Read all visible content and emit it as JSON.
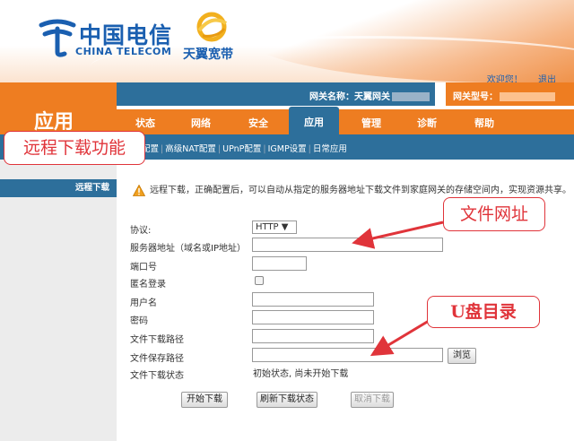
{
  "header": {
    "brand_cn": "中国电信",
    "brand_en": "CHINA TELECOM",
    "sub_brand": "天翼宽带",
    "welcome": "欢迎您！",
    "logout": "退出"
  },
  "app_title": "应用",
  "info_bar": {
    "gateway_name_label": "网关名称：天翼网关",
    "gateway_model_label": "网关型号："
  },
  "tabs": [
    {
      "label": "状态"
    },
    {
      "label": "网络"
    },
    {
      "label": "安全"
    },
    {
      "label": "应用"
    },
    {
      "label": "管理"
    },
    {
      "label": "诊断"
    },
    {
      "label": "帮助"
    }
  ],
  "subnav": [
    "S配置",
    "高级NAT配置",
    "UPnP配置",
    "IGMP设置",
    "日常应用"
  ],
  "sidebar": {
    "items": [
      {
        "label": "远程下载"
      }
    ]
  },
  "notice": "远程下载，正确配置后，可以自动从指定的服务器地址下载文件到家庭网关的存储空间内，实现资源共享。",
  "form": {
    "protocol_label": "协议:",
    "protocol_value": "HTTP",
    "server_label": "服务器地址（域名或IP地址）",
    "port_label": "端口号",
    "anonymous_label": "匿名登录",
    "username_label": "用户名",
    "password_label": "密码",
    "download_path_label": "文件下载路径",
    "save_path_label": "文件保存路径",
    "status_label": "文件下载状态",
    "status_value": "初始状态, 尚未开始下载",
    "browse_button": "浏览",
    "start_button": "开始下载",
    "refresh_button": "刷新下载状态",
    "cancel_button": "取消下载"
  },
  "annotations": {
    "feature": "远程下载功能",
    "file_url": "文件网址",
    "u_disk": "U盘目录"
  },
  "colors": {
    "orange": "#ee7d21",
    "blue": "#2d6f9b",
    "annotation_red": "#e0343a"
  }
}
